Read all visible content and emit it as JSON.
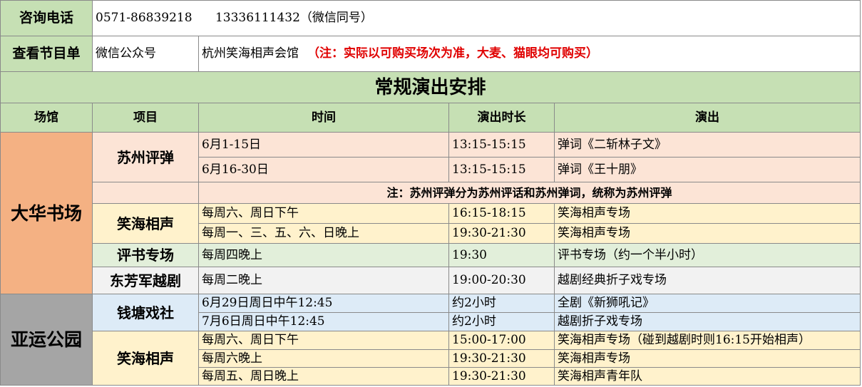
{
  "header": {
    "phone_label": "咨询电话",
    "phone_value": "0571-86839218      13336111432（微信同号）",
    "program_label": "查看节目单",
    "wechat_label": "微信公众号",
    "account_name": "杭州笑海相声会馆",
    "note_red": "（注：实际以可购买场次为准，大麦、猫眼均可购买）"
  },
  "title": "常规演出安排",
  "columns": [
    "场馆",
    "项目",
    "时间",
    "演出时长",
    "演出"
  ],
  "venues": [
    {
      "name": "大华书场",
      "items": [
        {
          "name": "苏州评弹",
          "rows": [
            {
              "time": "6月1-15日",
              "duration": "13:15-15:15",
              "show": "弹词《二斩林子文》"
            },
            {
              "time": "6月16-30日",
              "duration": "13:15-15:15",
              "show": "弹词《王十朋》"
            }
          ],
          "note": "注：苏州评弹分为苏州评话和苏州弹词，统称为苏州评弹"
        },
        {
          "name": "笑海相声",
          "rows": [
            {
              "time": "每周六、周日下午",
              "duration": "16:15-18:15",
              "show": "笑海相声专场"
            },
            {
              "time": "每周一、三、五、六、日晚上",
              "duration": "19:30-21:30",
              "show": "笑海相声专场"
            }
          ]
        },
        {
          "name": "评书专场",
          "rows": [
            {
              "time": "每周四晚上",
              "duration": "19:30",
              "show": "评书专场（约一个半小时）"
            }
          ]
        },
        {
          "name": "东芳军越剧",
          "rows": [
            {
              "time": "每周二晚上",
              "duration": "19:00-20:30",
              "show": "越剧经典折子戏专场"
            }
          ]
        }
      ]
    },
    {
      "name": "亚运公园",
      "items": [
        {
          "name": "钱塘戏社",
          "rows": [
            {
              "time": "6月29日周日中午12:45",
              "duration": "约2小时",
              "show": "全剧《新狮吼记》"
            },
            {
              "time": "7月6日周日中午12:45",
              "duration": "约2小时",
              "show": "越剧折子戏专场"
            }
          ]
        },
        {
          "name": "笑海相声",
          "rows": [
            {
              "time": "每周六、周日下午",
              "duration": "15:00-17:00",
              "show": "笑海相声专场（碰到越剧时则16:15开始相声）"
            },
            {
              "time": "每周六晚上",
              "duration": "19:30-21:30",
              "show": "笑海相声专场"
            },
            {
              "time": "每周五、周日晚上",
              "duration": "19:30-21:30",
              "show": "笑海相声青年队"
            }
          ]
        }
      ]
    }
  ]
}
